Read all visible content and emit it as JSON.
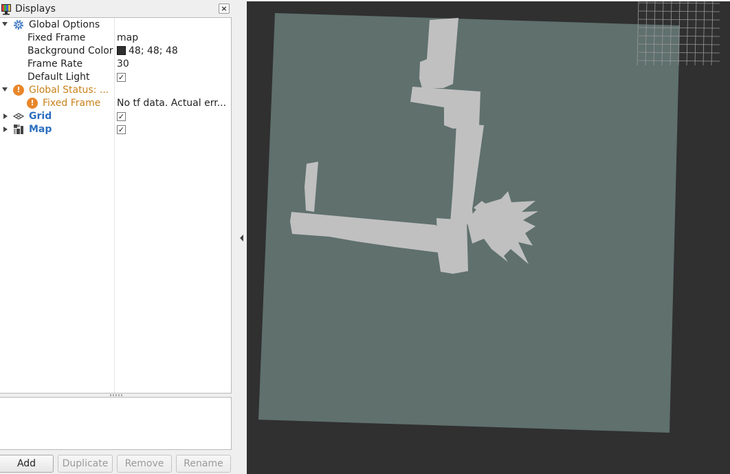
{
  "panel": {
    "title": "Displays",
    "close_glyph": "×",
    "icons": {
      "title": "monitor-icon",
      "global_options": "gear-icon",
      "global_status": "warning-icon",
      "fixed_frame_status": "warning-icon",
      "grid": "grid-icon",
      "map": "map-icon"
    },
    "colors": {
      "warning": "#c9811a",
      "display_name": "#2c6fbf"
    }
  },
  "tree": {
    "global_options": {
      "label": "Global Options",
      "fixed_frame": {
        "label": "Fixed Frame",
        "value": "map"
      },
      "background_color": {
        "label": "Background Color",
        "value": "48; 48; 48",
        "swatch": "#303030"
      },
      "frame_rate": {
        "label": "Frame Rate",
        "value": "30"
      },
      "default_light": {
        "label": "Default Light",
        "checked": true,
        "check_glyph": "✓"
      }
    },
    "global_status": {
      "label": "Global Status: ...",
      "fixed_frame": {
        "label": "Fixed Frame",
        "value": "No tf data.  Actual err..."
      }
    },
    "grid": {
      "label": "Grid",
      "checked": true,
      "check_glyph": "✓"
    },
    "map": {
      "label": "Map",
      "checked": true,
      "check_glyph": "✓"
    }
  },
  "buttons": {
    "add": "Add",
    "duplicate": "Duplicate",
    "remove": "Remove",
    "rename": "Rename"
  },
  "view3d": {
    "background": "#303030",
    "map_unknown_color": "#5f706d",
    "map_free_color": "#c0c0c0",
    "grid_color": "#9a9a9a"
  }
}
